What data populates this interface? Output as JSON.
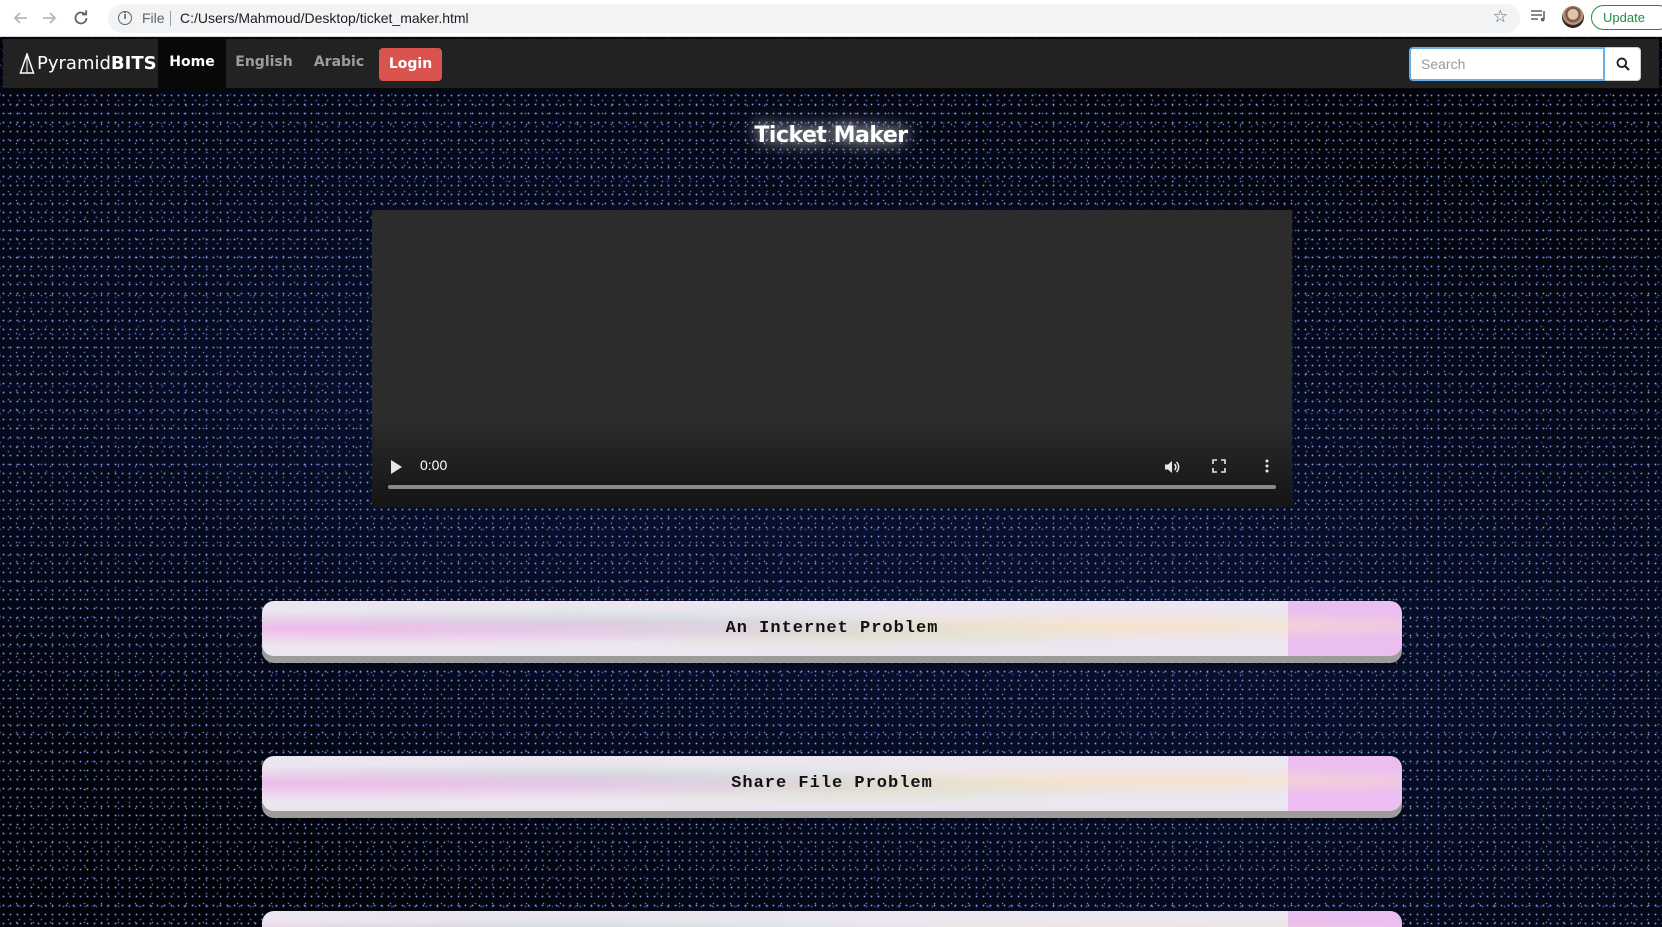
{
  "browser": {
    "url_scheme_label": "File",
    "url": "C:/Users/Mahmoud/Desktop/ticket_maker.html",
    "update_label": "Update"
  },
  "navbar": {
    "brand_light": "Pyramid",
    "brand_bold": "BITS",
    "items": [
      {
        "label": "Home",
        "active": true
      },
      {
        "label": "English",
        "active": false
      },
      {
        "label": "Arabic",
        "active": false
      }
    ],
    "login_label": "Login",
    "search_placeholder": "Search"
  },
  "main": {
    "title": "Ticket Maker",
    "video": {
      "current_time": "0:00"
    },
    "problems": [
      {
        "label": "An Internet Problem"
      },
      {
        "label": "Share File Problem"
      },
      {
        "label": ""
      }
    ]
  },
  "colors": {
    "navbar_bg": "#222222",
    "login_bg": "#d9534f",
    "update_green": "#1e8e3e"
  }
}
